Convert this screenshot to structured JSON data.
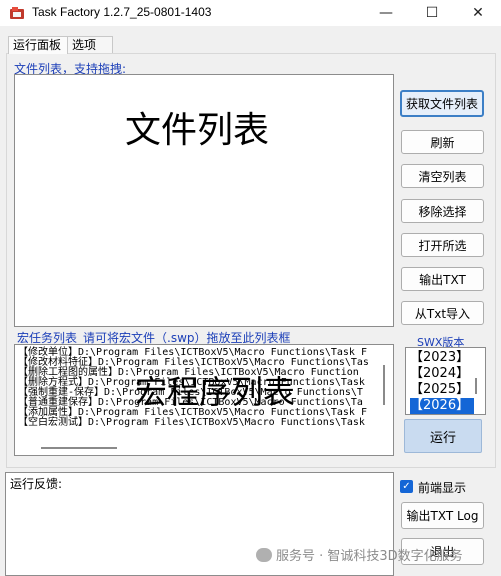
{
  "window": {
    "title": "Task Factory 1.2.7_25-0801-1403",
    "minimize_glyph": "—",
    "maximize_glyph": "☐",
    "close_glyph": "✕"
  },
  "tabs": [
    {
      "label": "运行面板",
      "active": true
    },
    {
      "label": "选项",
      "active": false
    }
  ],
  "file_section": {
    "label": "文件列表，支持拖拽:",
    "placeholder_big": "文件列表"
  },
  "buttons": {
    "get_file_list": "获取文件列表",
    "refresh": "刷新",
    "clear_list": "清空列表",
    "remove_selected": "移除选择",
    "open_selected": "打开所选",
    "export_txt": "输出TXT",
    "import_txt": "从Txt导入"
  },
  "macro_section": {
    "label": "宏任务列表_请可将宏文件（.swp）拖放至此列表框",
    "overlay": "宏程序列表",
    "rows": [
      "【修改单位】D:\\Program Files\\ICTBoxV5\\Macro Functions\\Task F",
      "【修改材料特征】D:\\Program Files\\ICTBoxV5\\Macro Functions\\Tas",
      "【删除工程图的属性】D:\\Program Files\\ICTBoxV5\\Macro Function",
      "【删除方程式】D:\\Program Files\\ICTBoxV5\\Macro Functions\\Task",
      "【强制重建-保存】D:\\Program Files\\ICTBoxV5\\Macro Functions\\T",
      "【普通重建保存】D:\\Program Files\\ICTBoxV5\\Macro Functions\\Ta",
      "【添加属性】D:\\Program Files\\ICTBoxV5\\Macro Functions\\Task F",
      "【空白宏测试】D:\\Program Files\\ICTBoxV5\\Macro Functions\\Task"
    ]
  },
  "swx": {
    "label": "SWX版本",
    "versions": [
      "【2023】",
      "【2024】",
      "【2025】",
      "【2026】"
    ],
    "selected_index": 3
  },
  "run_label": "运行",
  "feedback": {
    "label": "运行反馈:"
  },
  "front_display": {
    "label": "前端显示",
    "checked": true
  },
  "export_log_label": "输出TXT Log",
  "exit_label": "退出",
  "watermark": "服务号 · 智诚科技3D数字化服务"
}
